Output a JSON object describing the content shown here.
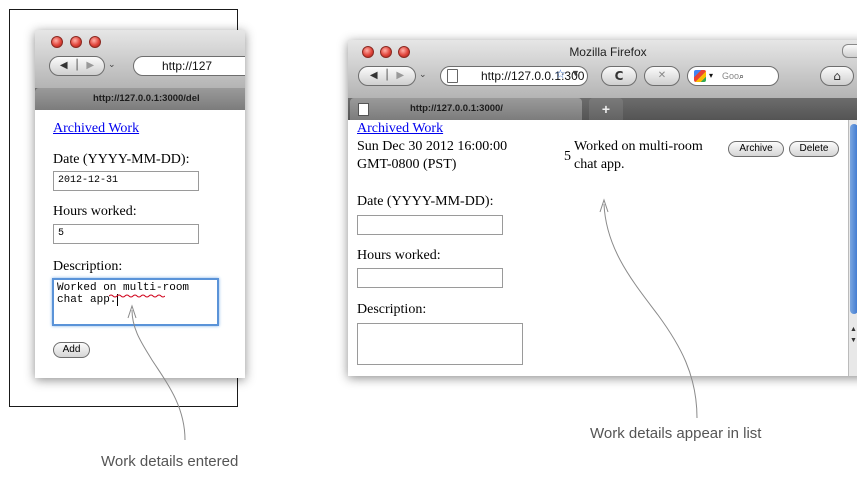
{
  "left_window": {
    "url": "http://127",
    "tab_url": "http://127.0.0.1:3000/del",
    "archived_link": "Archived Work",
    "date_label": "Date (YYYY-MM-DD):",
    "date_value": "2012-12-31",
    "hours_label": "Hours worked:",
    "hours_value": "5",
    "description_label": "Description:",
    "description_line1": "Worked on multi-room",
    "description_line2": "chat app.",
    "add_button": "Add"
  },
  "right_window": {
    "title": "Mozilla Firefox",
    "url": "http://127.0.0.1:300",
    "search_placeholder": "Goo",
    "tab_url": "http://127.0.0.1:3000/",
    "new_tab": "+",
    "archived_link": "Archived Work",
    "entry": {
      "date_line1": "Sun Dec 30 2012 16:00:00",
      "date_line2": "GMT-0800 (PST)",
      "hours": "5",
      "description_line1": "Worked on multi-room",
      "description_line2": "chat app.",
      "archive_button": "Archive",
      "delete_button": "Delete"
    },
    "date_label": "Date (YYYY-MM-DD):",
    "hours_label": "Hours worked:",
    "description_label": "Description:"
  },
  "captions": {
    "left": "Work details entered",
    "right": "Work details appear in list"
  },
  "colors": {
    "link": "#0000ee",
    "caption": "#555555",
    "focus_ring": "#5a93d8",
    "traffic_red": "#e0443a"
  }
}
